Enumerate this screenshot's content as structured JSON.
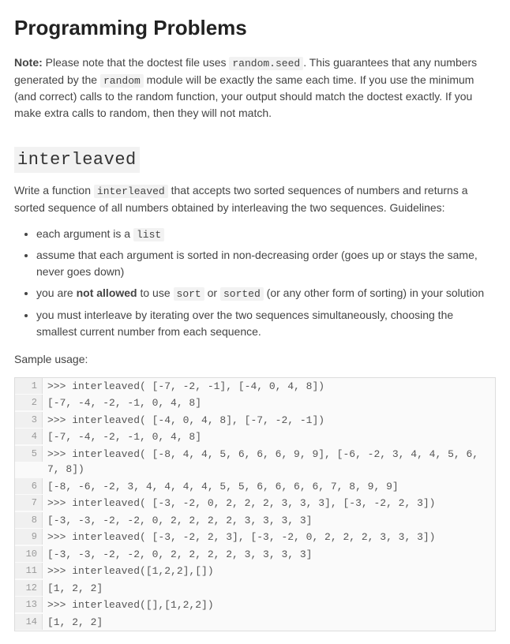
{
  "title": "Programming Problems",
  "note": {
    "label": "Note:",
    "t1": " Please note that the doctest file uses ",
    "c1": "random.seed",
    "t2": ". This guarantees that any numbers generated by the ",
    "c2": "random",
    "t3": " module will be exactly the same each time.  If you use the minimum (and correct) calls to the random function, your output should match the doctest exactly.  If you make extra calls to random, then they will not match."
  },
  "section_heading": "interleaved",
  "intro": {
    "t1": "Write a function ",
    "c1": "interleaved",
    "t2": " that accepts two sorted sequences of numbers and returns a sorted sequence of all numbers obtained by interleaving the two sequences.  Guidelines:"
  },
  "bullets": {
    "b1a": "each argument is a ",
    "b1c": "list",
    "b2": "assume that each argument is sorted in non-decreasing order (goes up or stays the same, never goes down)",
    "b3a": "you are ",
    "b3strong": "not allowed",
    "b3b": " to use ",
    "b3c1": "sort",
    "b3c": " or ",
    "b3c2": "sorted",
    "b3d": " (or any other form of sorting) in your solution",
    "b4": "you must interleave by iterating over the two sequences simultaneously, choosing the smallest current number from each sequence."
  },
  "sample_label": "Sample usage:",
  "code": {
    "l1": ">>> interleaved( [-7, -2, -1], [-4, 0, 4, 8])",
    "l2": "[-7, -4, -2, -1, 0, 4, 8]",
    "l3": ">>> interleaved( [-4, 0, 4, 8], [-7, -2, -1])",
    "l4": "[-7, -4, -2, -1, 0, 4, 8]",
    "l5": ">>> interleaved( [-8, 4, 4, 5, 6, 6, 6, 9, 9], [-6, -2, 3, 4, 4, 5, 6, 7, 8])",
    "l6": "[-8, -6, -2, 3, 4, 4, 4, 4, 5, 5, 6, 6, 6, 6, 7, 8, 9, 9]",
    "l7": ">>> interleaved( [-3, -2, 0, 2, 2, 2, 3, 3, 3], [-3, -2, 2, 3])",
    "l8": "[-3, -3, -2, -2, 0, 2, 2, 2, 2, 3, 3, 3, 3]",
    "l9": ">>> interleaved( [-3, -2, 2, 3], [-3, -2, 0, 2, 2, 2, 3, 3, 3])",
    "l10": "[-3, -3, -2, -2, 0, 2, 2, 2, 2, 3, 3, 3, 3]",
    "l11": ">>> interleaved([1,2,2],[])",
    "l12": "[1, 2, 2]",
    "l13": ">>> interleaved([],[1,2,2])",
    "l14": "[1, 2, 2]"
  }
}
